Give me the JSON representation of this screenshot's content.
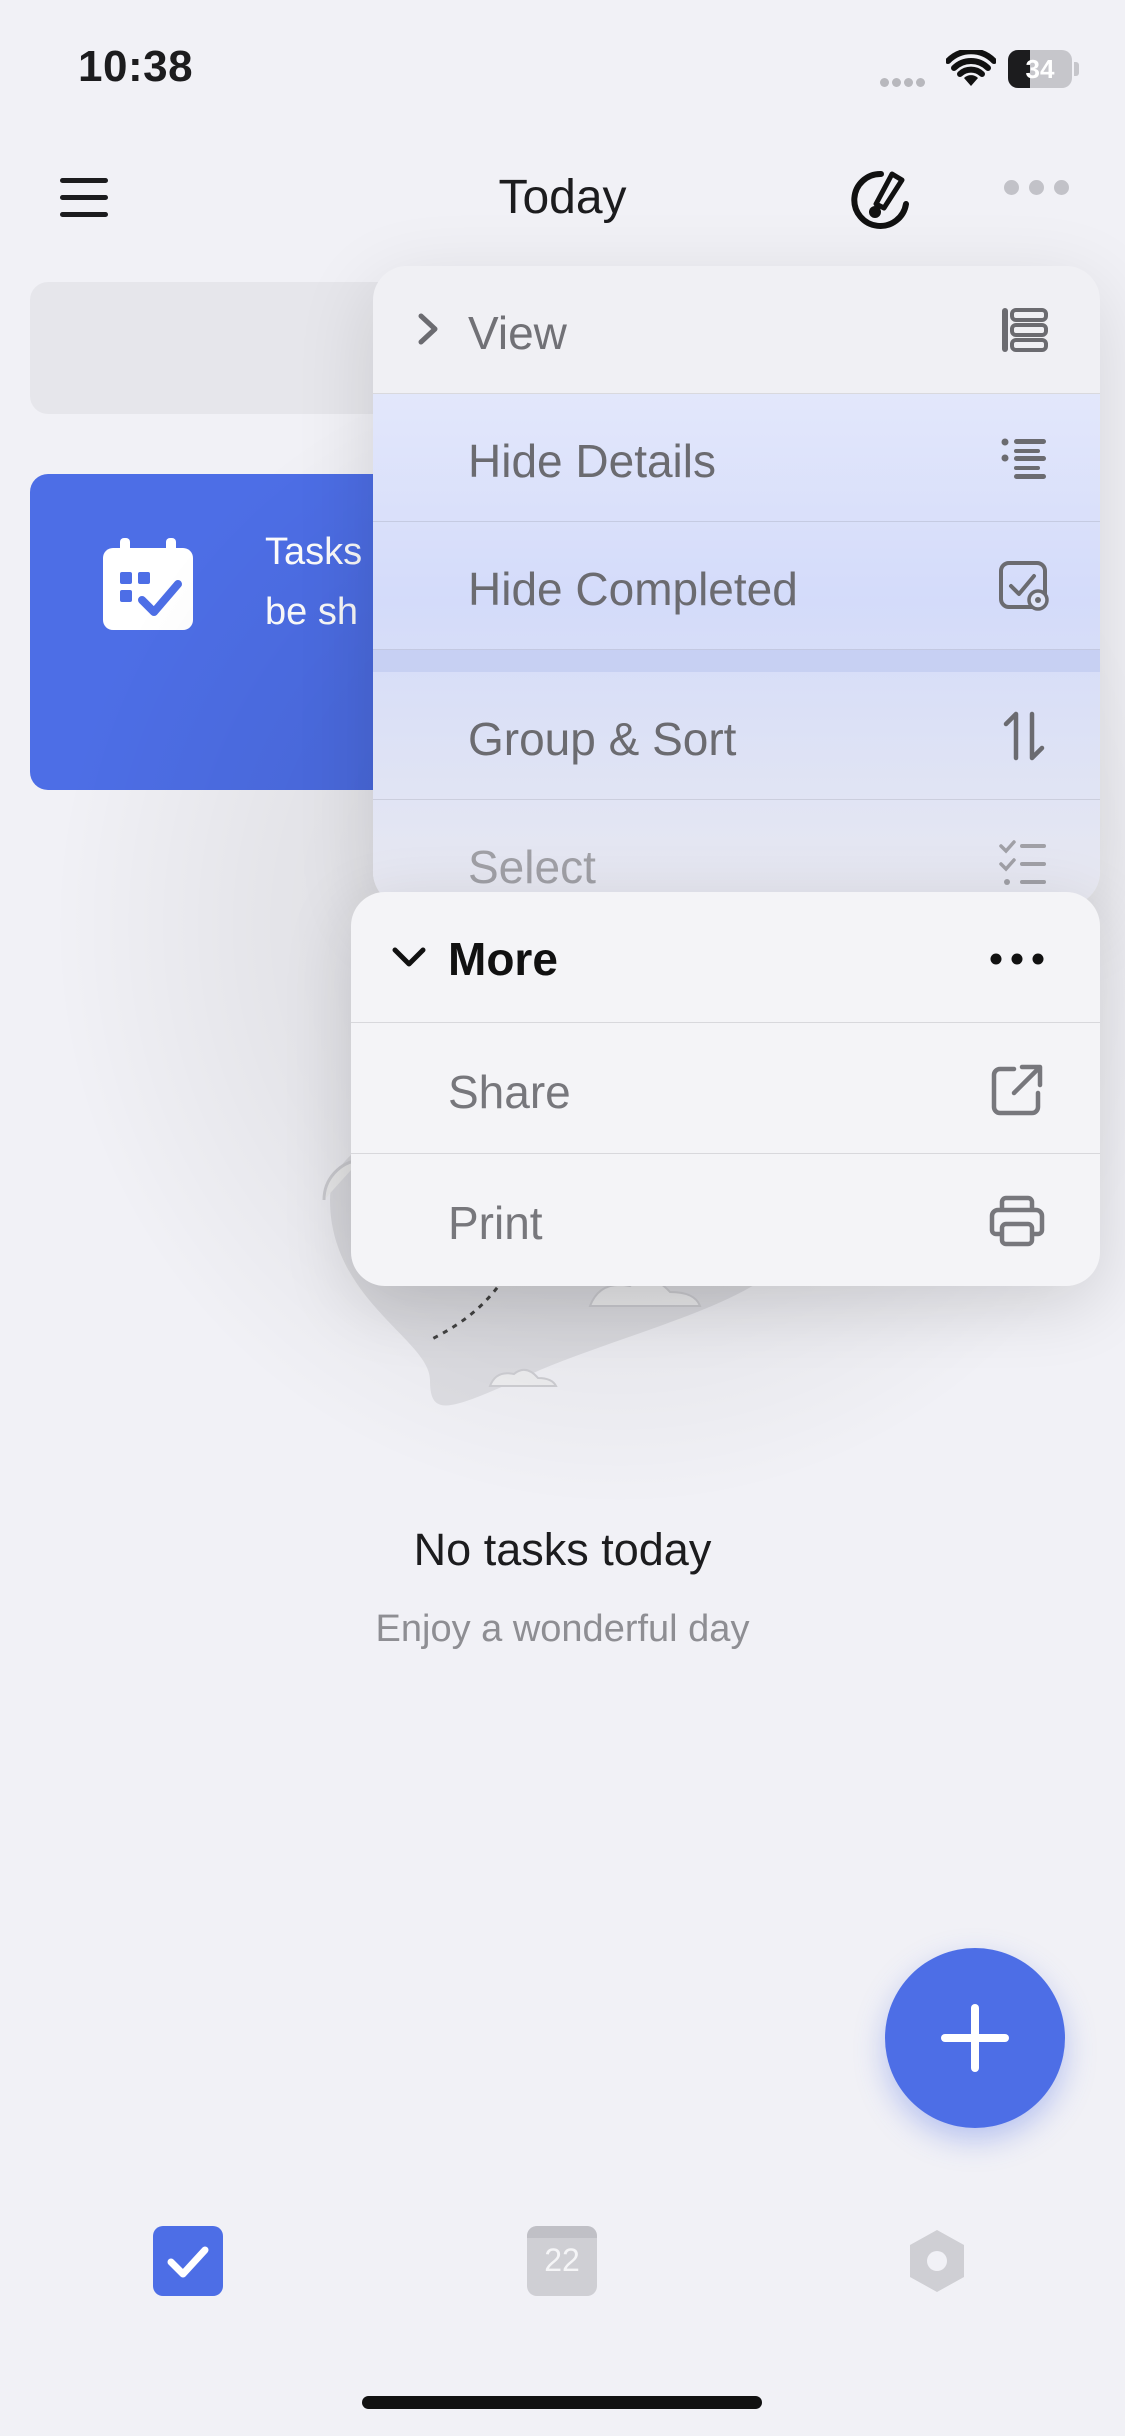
{
  "status_bar": {
    "time": "10:38",
    "battery": "34"
  },
  "nav": {
    "title": "Today",
    "icons": [
      "menu-icon",
      "brush-icon",
      "more-icon"
    ]
  },
  "promo": {
    "text_line1": "Tasks",
    "text_line2": "be sh"
  },
  "empty_state": {
    "title": "No tasks today",
    "subtitle": "Enjoy a wonderful day"
  },
  "menu": {
    "items": [
      {
        "label": "View",
        "icon": "view-list-icon"
      },
      {
        "label": "Hide Details",
        "icon": "list-details-icon"
      },
      {
        "label": "Hide Completed",
        "icon": "checkbox-completed-icon"
      },
      {
        "label": "Group & Sort",
        "icon": "sort-arrows-icon"
      },
      {
        "label": "Select",
        "icon": "checklist-icon"
      }
    ]
  },
  "submenu": {
    "header": "More",
    "items": [
      {
        "label": "Share",
        "icon": "share-icon"
      },
      {
        "label": "Print",
        "icon": "print-icon"
      }
    ]
  },
  "tabs": {
    "calendar_day": "22"
  },
  "colors": {
    "accent": "#4d6ee6",
    "background": "#f1f1f6"
  }
}
